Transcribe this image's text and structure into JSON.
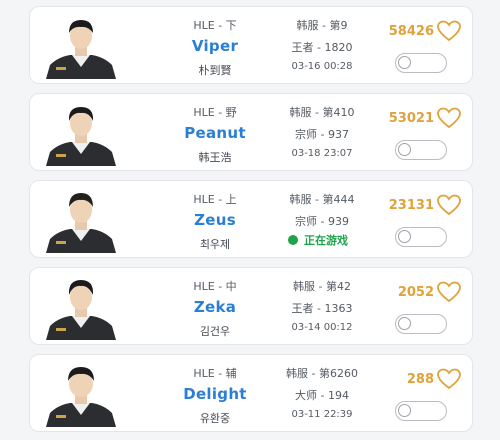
{
  "players": [
    {
      "team_pos": "HLE - 下",
      "name": "Viper",
      "realname": "朴到賢",
      "rank": "韩服 - 第9",
      "tier": "王者 - 1820",
      "status": "03-16 00:28",
      "live": false,
      "fans": "58426",
      "notify_enabled": false
    },
    {
      "team_pos": "HLE - 野",
      "name": "Peanut",
      "realname": "韩王浩",
      "rank": "韩服 - 第410",
      "tier": "宗师 - 937",
      "status": "03-18 23:07",
      "live": false,
      "fans": "53021",
      "notify_enabled": false
    },
    {
      "team_pos": "HLE - 上",
      "name": "Zeus",
      "realname": "최우제",
      "rank": "韩服 - 第444",
      "tier": "宗师 - 939",
      "status": "正在游戏",
      "live": true,
      "fans": "23131",
      "notify_enabled": false
    },
    {
      "team_pos": "HLE - 中",
      "name": "Zeka",
      "realname": "김건우",
      "rank": "韩服 - 第42",
      "tier": "王者 - 1363",
      "status": "03-14 00:12",
      "live": false,
      "fans": "2052",
      "notify_enabled": false
    },
    {
      "team_pos": "HLE - 辅",
      "name": "Delight",
      "realname": "유환중",
      "rank": "韩服 - 第6260",
      "tier": "大师 - 194",
      "status": "03-11 22:39",
      "live": false,
      "fans": "288",
      "notify_enabled": false
    }
  ],
  "icons": {
    "favorite": "heart-outline-icon",
    "live_indicator": "green-dot-icon"
  },
  "colors": {
    "name": "#2a7fd4",
    "fans": "#e0a23a",
    "live": "#1fa34a",
    "card_bg": "#ffffff",
    "page_bg": "#f4f5f7"
  }
}
